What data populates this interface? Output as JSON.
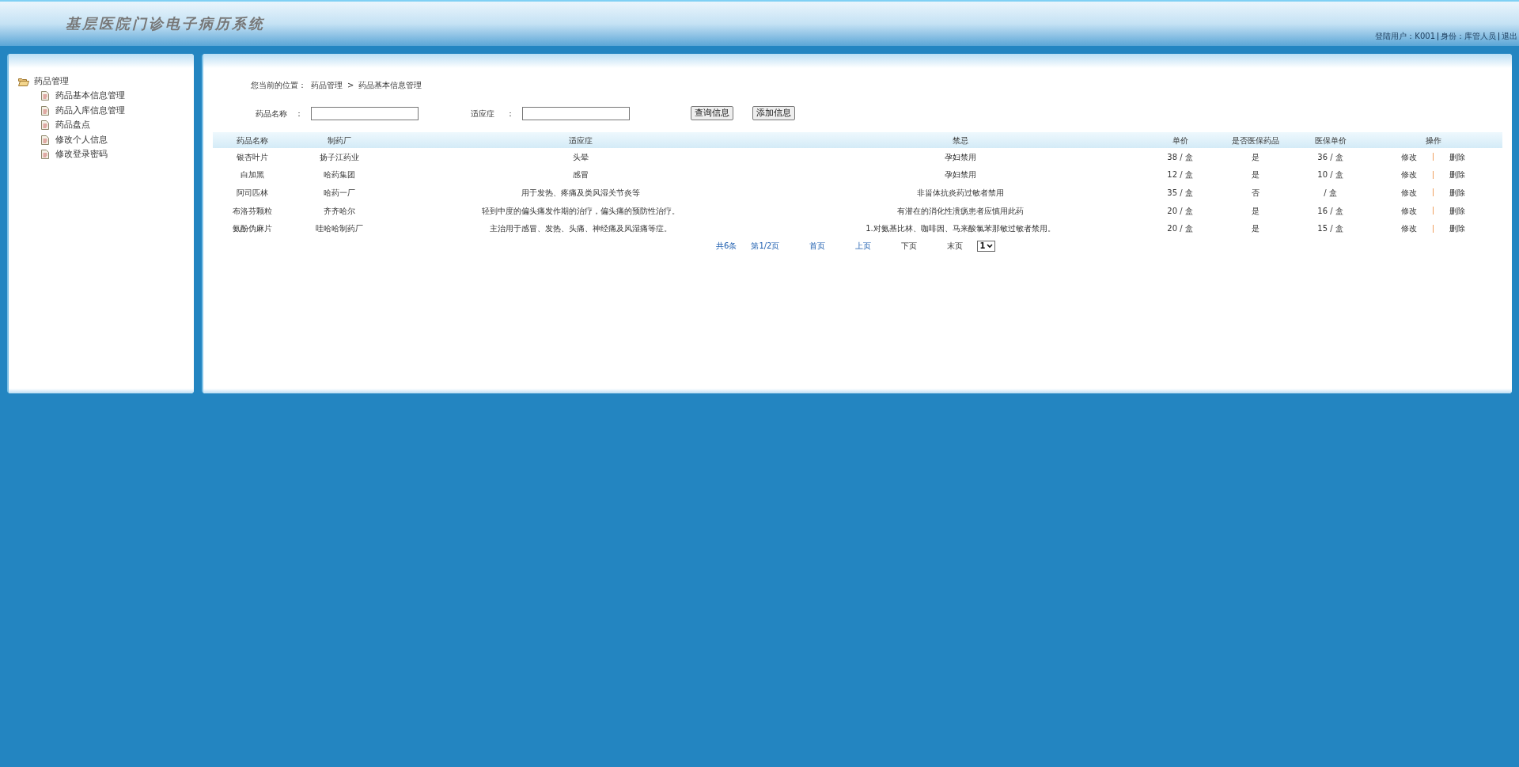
{
  "header": {
    "title": "基层医院门诊电子病历系统",
    "user_label": "登陆用户：",
    "user": "K001",
    "role_label": "身份：",
    "role": "库管人员",
    "logout": "退出"
  },
  "sidebar": {
    "group": {
      "label": "药品管理",
      "expanded": true,
      "children": [
        {
          "label": "药品基本信息管理"
        },
        {
          "label": "药品入库信息管理"
        },
        {
          "label": "药品盘点"
        },
        {
          "label": "修改个人信息"
        },
        {
          "label": "修改登录密码"
        }
      ]
    }
  },
  "breadcrumb": {
    "label": "您当前的位置：",
    "items": [
      "药品管理",
      "药品基本信息管理"
    ],
    "separator": ">"
  },
  "search": {
    "fields": [
      {
        "label": "药品名称",
        "colon": "："
      },
      {
        "label": "适应症",
        "colon": "："
      }
    ],
    "buttons": [
      "查询信息",
      "添加信息"
    ]
  },
  "table": {
    "columns": [
      "药品名称",
      "制药厂",
      "适应症",
      "禁忌",
      "单价",
      "是否医保药品",
      "医保单价",
      "操作"
    ],
    "rows": [
      {
        "cells": [
          "银杏叶片",
          "扬子江药业",
          "头晕",
          "孕妇禁用",
          "38 / 盒",
          "是",
          "36 / 盒"
        ],
        "actions": [
          "修改",
          "删除"
        ]
      },
      {
        "cells": [
          "白加黑",
          "哈药集团",
          "感冒",
          "孕妇禁用",
          "12 / 盒",
          "是",
          "10 / 盒"
        ],
        "actions": [
          "修改",
          "删除"
        ]
      },
      {
        "cells": [
          "阿司匹林",
          "哈药一厂",
          "用于发热、疼痛及类风湿关节炎等",
          "非甾体抗炎药过敏者禁用",
          "35 / 盒",
          "否",
          "/ 盒"
        ],
        "actions": [
          "修改",
          "删除"
        ]
      },
      {
        "cells": [
          "布洛芬颗粒",
          "齐齐哈尔",
          "轻到中度的偏头痛发作期的治疗，偏头痛的预防性治疗。",
          "有潜在的消化性溃疡患者应慎用此药",
          "20 / 盒",
          "是",
          "16 / 盒"
        ],
        "actions": [
          "修改",
          "删除"
        ]
      },
      {
        "cells": [
          "氨酚伪麻片",
          "哇哈哈制药厂",
          "主治用于感冒、发热、头痛、神经痛及风湿痛等症。",
          "1.对氨基比林、咖啡因、马来酸氯苯那敏过敏者禁用。",
          "20 / 盒",
          "是",
          "15 / 盒"
        ],
        "actions": [
          "修改",
          "删除"
        ]
      }
    ]
  },
  "pagination": {
    "total": "共6条",
    "page": "第1/2页",
    "links": [
      "首页",
      "上页",
      "下页",
      "末页"
    ],
    "select": "1"
  }
}
